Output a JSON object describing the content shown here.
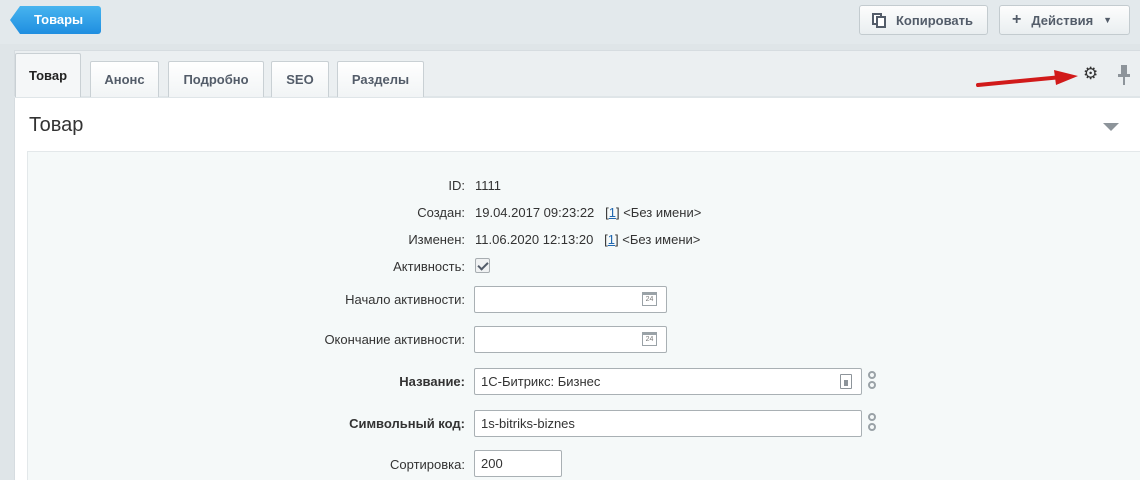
{
  "toolbar": {
    "back_label": "Товары",
    "copy_label": "Копировать",
    "actions_label": "Действия",
    "actions_caret": "▼",
    "plus": "+"
  },
  "tabs": [
    {
      "label": "Товар",
      "active": true
    },
    {
      "label": "Анонс"
    },
    {
      "label": "Подробно"
    },
    {
      "label": "SEO"
    },
    {
      "label": "Разделы"
    }
  ],
  "panel": {
    "title": "Товар",
    "icons": [
      "gear-icon",
      "pin-icon",
      "collapse-icon"
    ]
  },
  "form": {
    "id": {
      "label": "ID:",
      "value": "1111"
    },
    "created": {
      "label": "Создан:",
      "date": "19.04.2017 09:23:22",
      "user_link": "1",
      "user_name": "<Без имени>"
    },
    "modified": {
      "label": "Изменен:",
      "date": "11.06.2020 12:13:20",
      "user_link": "1",
      "user_name": "<Без имени>"
    },
    "active": {
      "label": "Активность:",
      "checked": true
    },
    "active_from": {
      "label": "Начало активности:",
      "value": "",
      "calendar_text": "24"
    },
    "active_to": {
      "label": "Окончание активности:",
      "value": "",
      "calendar_text": "24"
    },
    "name": {
      "label": "Название:",
      "value": "1С-Битрикс: Бизнес"
    },
    "code": {
      "label": "Символьный код:",
      "value": "1s-bitriks-biznes"
    },
    "sort": {
      "label": "Сортировка:",
      "value": "200"
    }
  },
  "colors": {
    "accent": "#2a9be8",
    "link": "#2067b0",
    "annotation_arrow": "#d11a1a"
  }
}
